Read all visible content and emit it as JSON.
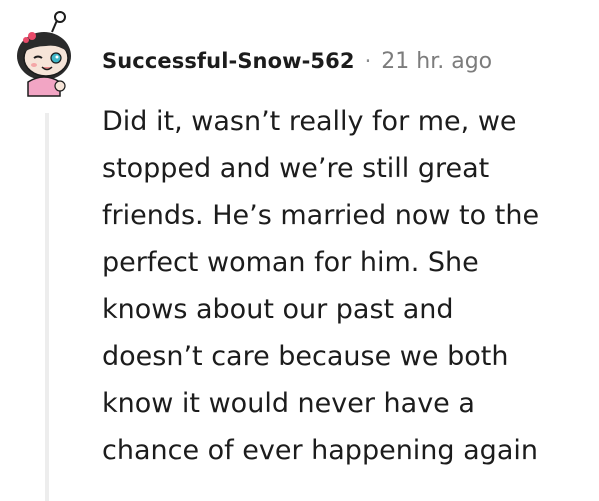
{
  "comment": {
    "author": "Successful-Snow-562",
    "separator": "·",
    "timestamp": "21 hr. ago",
    "avatar_icon": "snoo-avatar-icon",
    "body_lines": [
      "Did it, wasn’t really for me, we",
      "stopped and we’re still great",
      "friends. He’s married now to the",
      "perfect woman for him. She",
      "knows about our past and",
      "doesn’t care because we both",
      "know it would never have a",
      "chance of ever happening again"
    ]
  },
  "colors": {
    "text": "#1c1c1c",
    "meta": "#7c7c7c",
    "thread_line": "#ededed",
    "avatar_skin": "#f6e4d8",
    "avatar_hair": "#2b2b2b",
    "avatar_eye": "#3fb6c8",
    "avatar_shirt": "#f2a5c4"
  }
}
